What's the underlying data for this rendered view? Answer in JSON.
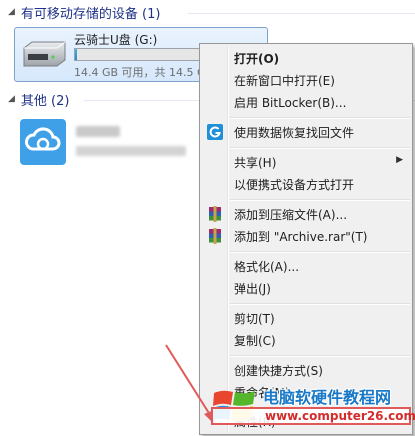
{
  "groups": [
    {
      "label": "有可移动存储的设备 (1)"
    },
    {
      "label": "其他 (2)"
    }
  ],
  "drive": {
    "name": "云骑士U盘 (G:)",
    "free_text": "14.4 GB 可用，共 14.5 GB",
    "usage_fraction": 0.01,
    "bar_color": "#2389c9"
  },
  "cloud": {
    "icon": "cloud-drive-icon",
    "color": "#3fa0e8"
  },
  "context_menu": {
    "items": [
      {
        "label": "打开(O)",
        "bold": true
      },
      {
        "label": "在新窗口中打开(E)"
      },
      {
        "label": "启用 BitLocker(B)..."
      },
      {
        "label": "使用数据恢复找回文件",
        "icon": "data-recovery-icon"
      },
      {
        "label": "共享(H)",
        "submenu": true
      },
      {
        "label": "以便携式设备方式打开"
      },
      {
        "label": "添加到压缩文件(A)...",
        "icon": "winrar-icon"
      },
      {
        "label": "添加到 \"Archive.rar\"(T)",
        "icon": "winrar-icon"
      },
      {
        "label": "格式化(A)..."
      },
      {
        "label": "弹出(J)"
      },
      {
        "label": "剪切(T)"
      },
      {
        "label": "复制(C)"
      },
      {
        "label": "创建快捷方式(S)"
      },
      {
        "label": "重命名(M)"
      },
      {
        "label": "属性(R)"
      }
    ]
  },
  "watermark": {
    "title": "电脑软硬件教程网",
    "url": "www.computer26.com"
  },
  "colors": {
    "accent": "#1e3287",
    "annotation_arrow": "#e05a5a"
  }
}
